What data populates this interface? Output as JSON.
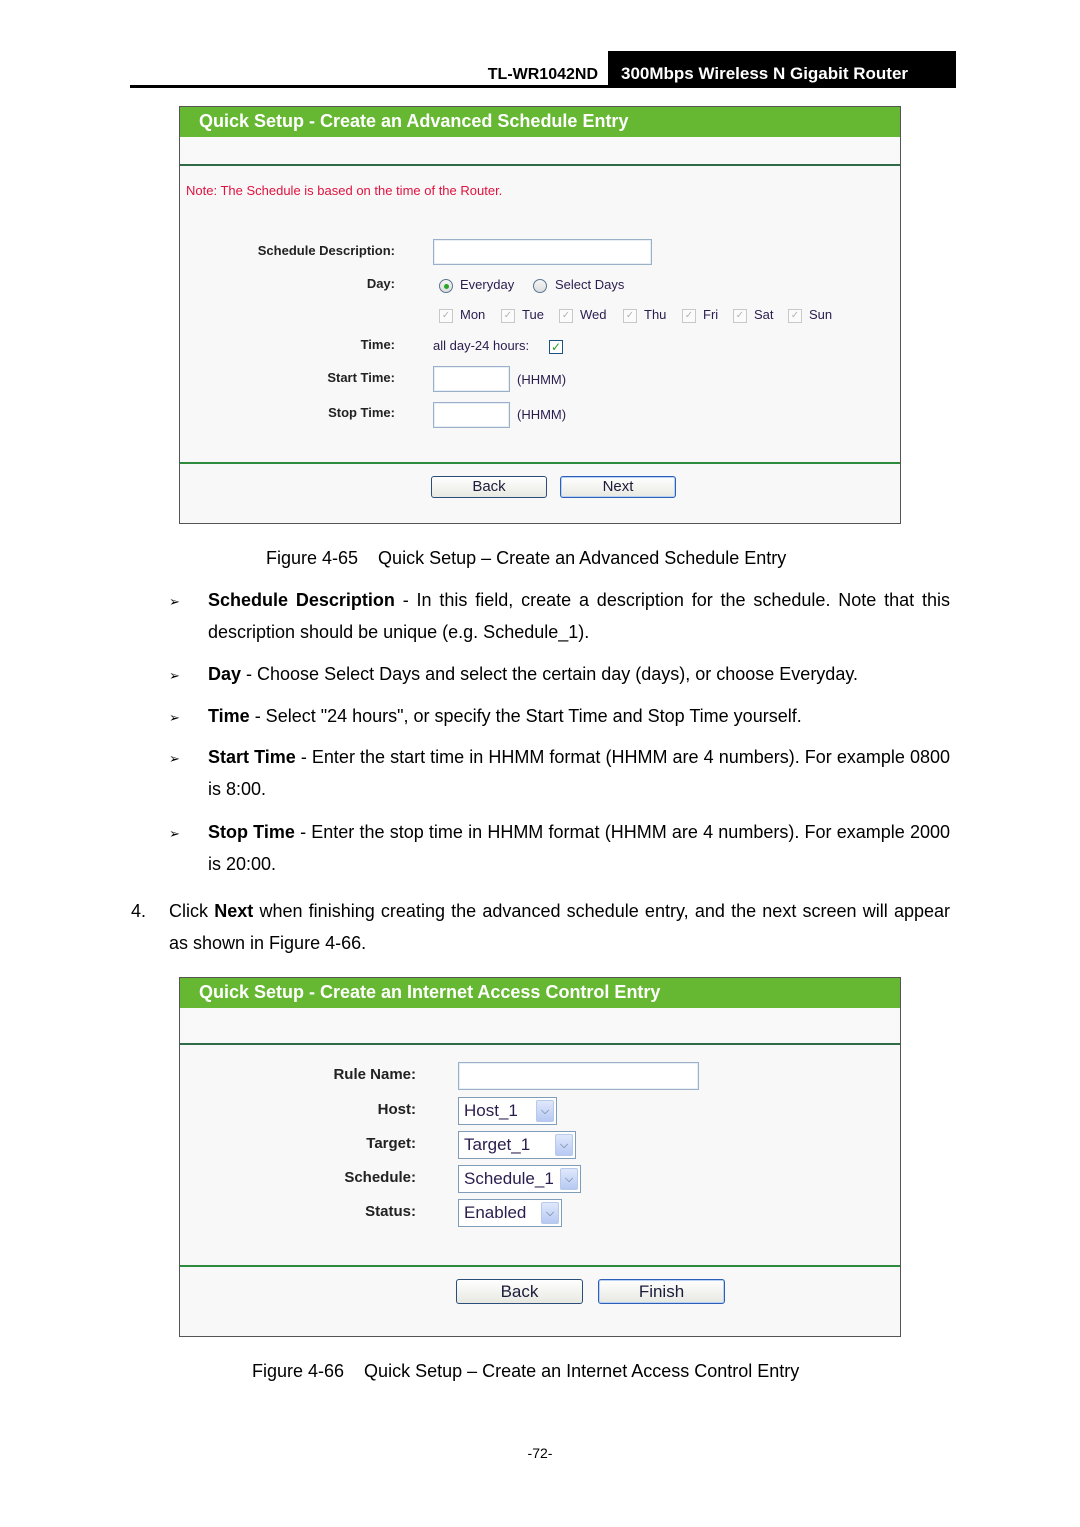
{
  "header": {
    "model": "TL-WR1042ND",
    "product": "300Mbps Wireless N Gigabit Router"
  },
  "figure65": {
    "panel_title": "Quick Setup - Create an Advanced Schedule Entry",
    "note": "Note: The Schedule is based on the time of the Router.",
    "labels": {
      "description": "Schedule Description:",
      "day": "Day:",
      "time": "Time:",
      "start": "Start Time:",
      "stop": "Stop Time:"
    },
    "description_value": "",
    "day_options": [
      {
        "label": "Everyday",
        "selected": true
      },
      {
        "label": "Select Days",
        "selected": false
      }
    ],
    "days": [
      {
        "label": "Mon",
        "checked": true,
        "disabled": true
      },
      {
        "label": "Tue",
        "checked": true,
        "disabled": true
      },
      {
        "label": "Wed",
        "checked": true,
        "disabled": true
      },
      {
        "label": "Thu",
        "checked": true,
        "disabled": true
      },
      {
        "label": "Fri",
        "checked": true,
        "disabled": true
      },
      {
        "label": "Sat",
        "checked": true,
        "disabled": true
      },
      {
        "label": "Sun",
        "checked": true,
        "disabled": true
      }
    ],
    "all_day_label": "all day-24 hours:",
    "all_day_checked": true,
    "start_value": "",
    "stop_value": "",
    "format_hint": "(HHMM)",
    "buttons": {
      "back": "Back",
      "next": "Next"
    },
    "caption": "Figure 4-65    Quick Setup – Create an Advanced Schedule Entry"
  },
  "bullets": [
    {
      "term": "Schedule Description",
      "text": " - In this field, create a description for the schedule. Note that this description should be unique (e.g. Schedule_1)."
    },
    {
      "term": "Day",
      "text": " - Choose Select Days and select the certain day (days), or choose Everyday."
    },
    {
      "term": "Time",
      "text": " - Select \"24 hours\", or specify the Start Time and Stop Time yourself."
    },
    {
      "term": "Start Time",
      "text": " - Enter the start time in HHMM format (HHMM are 4 numbers). For example 0800 is 8:00."
    },
    {
      "term": "Stop Time",
      "text": " - Enter the stop time in HHMM format (HHMM are 4 numbers). For example 2000 is 20:00."
    }
  ],
  "bullet_glyph": "➢",
  "step4": {
    "number": "4.",
    "pre": "Click ",
    "bold": "Next",
    "post": " when finishing creating the advanced schedule entry, and the next screen will appear as shown in Figure 4-66."
  },
  "figure66": {
    "panel_title": "Quick Setup - Create an Internet Access Control Entry",
    "labels": {
      "rule": "Rule Name:",
      "host": "Host:",
      "target": "Target:",
      "schedule": "Schedule:",
      "status": "Status:"
    },
    "rule_value": "",
    "host_value": "Host_1",
    "target_value": "Target_1",
    "schedule_value": "Schedule_1",
    "status_value": "Enabled",
    "dropdown_icon": "chevron-down",
    "buttons": {
      "back": "Back",
      "finish": "Finish"
    },
    "caption": "Figure 4-66    Quick Setup – Create an Internet Access Control Entry"
  },
  "page_number": "-72-",
  "colors": {
    "panel_header": "#66b832",
    "note_text": "#e0123f",
    "separator": "#2e8b3d"
  }
}
